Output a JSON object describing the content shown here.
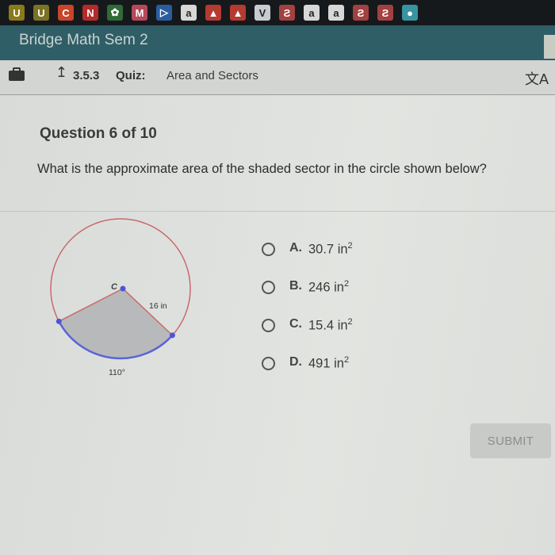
{
  "bookmarks": [
    {
      "icon": "u-app-icon",
      "glyph": "U",
      "color": "#8a7a1c"
    },
    {
      "icon": "u-app-icon",
      "glyph": "U",
      "color": "#7c7224"
    },
    {
      "icon": "crunchyroll-icon",
      "glyph": "C",
      "color": "#c7452a"
    },
    {
      "icon": "netflix-icon",
      "glyph": "N",
      "color": "#b52a2a"
    },
    {
      "icon": "plant-icon",
      "glyph": "✿",
      "color": "#2f6b34"
    },
    {
      "icon": "m-app-icon",
      "glyph": "M",
      "color": "#b5485a"
    },
    {
      "icon": "play-icon",
      "glyph": "▷",
      "color": "#2b5d9e"
    },
    {
      "icon": "amazon-icon",
      "glyph": "a",
      "color": "#d7d7d7"
    },
    {
      "icon": "red-hat-icon",
      "glyph": "▲",
      "color": "#b53a30"
    },
    {
      "icon": "red-hat-icon",
      "glyph": "▲",
      "color": "#b53a30"
    },
    {
      "icon": "vimeo-icon",
      "glyph": "V",
      "color": "#c8ccd0"
    },
    {
      "icon": "red-app-icon",
      "glyph": "Ƨ",
      "color": "#a34040"
    },
    {
      "icon": "amazon-icon",
      "glyph": "a",
      "color": "#d7d7d7"
    },
    {
      "icon": "amazon-icon",
      "glyph": "a",
      "color": "#d7d7d7"
    },
    {
      "icon": "red-app-icon",
      "glyph": "Ƨ",
      "color": "#a34040"
    },
    {
      "icon": "red-app-icon",
      "glyph": "Ƨ",
      "color": "#a34040"
    },
    {
      "icon": "teal-app-icon",
      "glyph": "●",
      "color": "#3a93a0"
    }
  ],
  "app": {
    "title": "Bridge Math Sem 2"
  },
  "quiz": {
    "number": "3.5.3",
    "label": "Quiz:",
    "name": "Area and Sectors"
  },
  "question": {
    "counter": "Question 6 of 10",
    "text": "What is the approximate area of the shaded sector in the circle shown below?"
  },
  "figure": {
    "center_label": "C",
    "radius_label": "16 in",
    "angle_label": "110°",
    "radius": 16,
    "angle_degrees": 110,
    "colors": {
      "circle": "#c86a6a",
      "arc": "#5a63d6",
      "shade": "#b8b9ba",
      "point": "#4a55d8"
    }
  },
  "answers": [
    {
      "letter": "A.",
      "value": "30.7 in",
      "exp": "2"
    },
    {
      "letter": "B.",
      "value": "246 in",
      "exp": "2"
    },
    {
      "letter": "C.",
      "value": "15.4 in",
      "exp": "2"
    },
    {
      "letter": "D.",
      "value": "491 in",
      "exp": "2"
    }
  ],
  "submit_label": "SUBMIT"
}
